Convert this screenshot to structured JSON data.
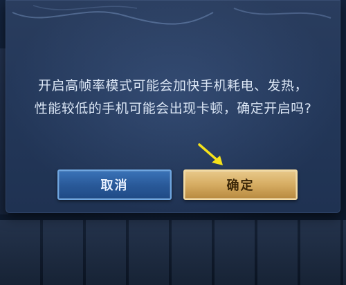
{
  "dialog": {
    "message_line1": "开启高帧率模式可能会加快手机耗电、发热，",
    "message_line2": "性能较低的手机可能会出现卡顿，确定开启吗?",
    "cancel_label": "取消",
    "confirm_label": "确定"
  },
  "colors": {
    "dialog_bg": "#24385a",
    "cancel_button": "#2a5a9a",
    "confirm_button": "#d6ac62",
    "arrow": "#f5e21a",
    "message_text": "#dbe6f5"
  },
  "icons": {
    "pointer": "yellow-arrow-icon"
  }
}
